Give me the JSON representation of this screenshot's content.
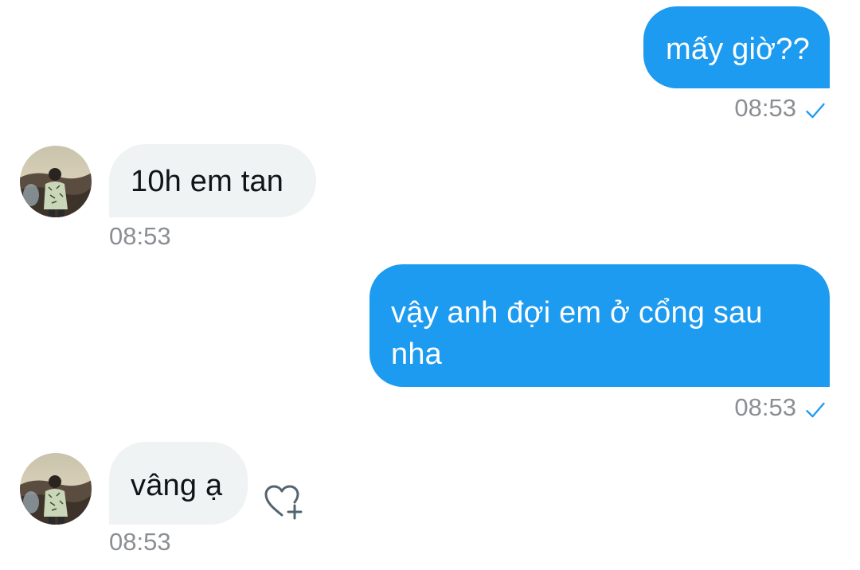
{
  "messages": [
    {
      "direction": "sent",
      "text": "mấy giờ??",
      "time": "08:53",
      "status_icon": "check-icon"
    },
    {
      "direction": "received",
      "text": "10h em tan",
      "time": "08:53",
      "avatar_icon": "avatar"
    },
    {
      "direction": "sent",
      "text_line1": "vậy anh đợi em ở cổng sau",
      "text_line2": "nha",
      "time": "08:53",
      "status_icon": "check-icon"
    },
    {
      "direction": "received",
      "text": "vâng ạ",
      "time": "08:53",
      "avatar_icon": "avatar",
      "reaction_icon": "heart-plus-icon"
    }
  ],
  "colors": {
    "sent_bubble": "#1d9bf0",
    "received_bubble": "#eff3f4",
    "timestamp": "#8b8f94",
    "check": "#1d9bf0"
  }
}
